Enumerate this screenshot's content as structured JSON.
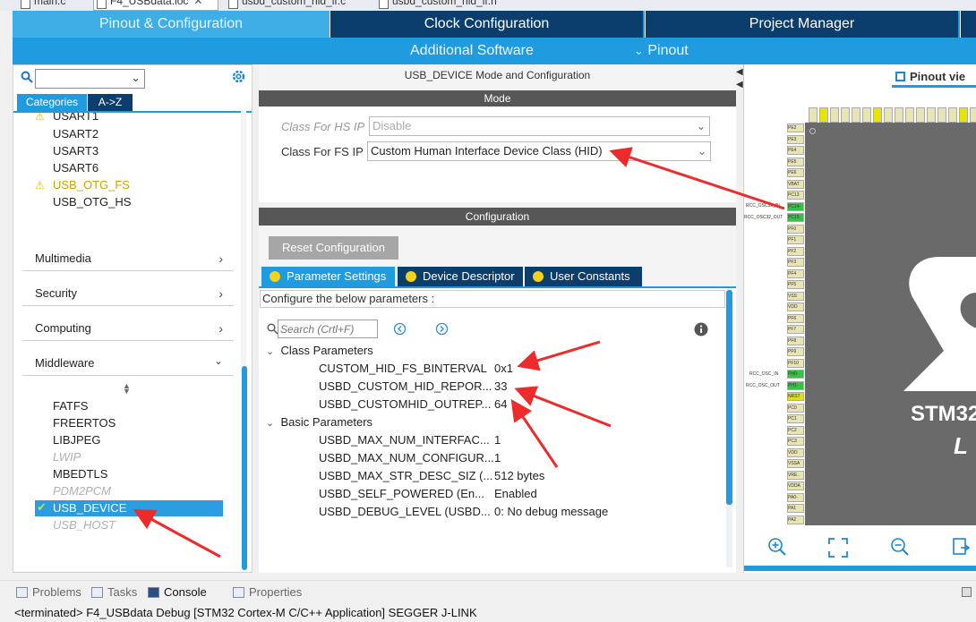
{
  "editor_tabs": [
    {
      "label": "main.c"
    },
    {
      "label": "F4_USBdata.ioc",
      "close": "✕"
    },
    {
      "label": "usbd_custom_hid_if.c"
    },
    {
      "label": "usbd_custom_hid_if.h"
    }
  ],
  "topnav": {
    "tabs": [
      "Pinout & Configuration",
      "Clock Configuration",
      "Project Manager"
    ],
    "additional_software": "Additional Software",
    "pinout": "Pinout"
  },
  "left": {
    "search_value": "",
    "category_tabs": [
      "Categories",
      "A->Z"
    ],
    "connectivity_items": [
      {
        "label": "USART1",
        "warn": true
      },
      {
        "label": "USART2",
        "warn": false
      },
      {
        "label": "USART3",
        "warn": false
      },
      {
        "label": "USART6",
        "warn": false
      },
      {
        "label": "USB_OTG_FS",
        "warn": true
      },
      {
        "label": "USB_OTG_HS",
        "warn": false
      }
    ],
    "groups": [
      "Multimedia",
      "Security",
      "Computing",
      "Middleware"
    ],
    "middleware_items": [
      {
        "label": "FATFS",
        "state": "normal"
      },
      {
        "label": "FREERTOS",
        "state": "normal"
      },
      {
        "label": "LIBJPEG",
        "state": "normal"
      },
      {
        "label": "LWIP",
        "state": "disabled"
      },
      {
        "label": "MBEDTLS",
        "state": "normal"
      },
      {
        "label": "PDM2PCM",
        "state": "disabled"
      },
      {
        "label": "USB_DEVICE",
        "state": "selected"
      },
      {
        "label": "USB_HOST",
        "state": "disabled"
      }
    ]
  },
  "mode": {
    "header": "USB_DEVICE Mode and Configuration",
    "section": "Mode",
    "hs_label": "Class For HS IP",
    "hs_value": "Disable",
    "fs_label": "Class For FS IP",
    "fs_value": "Custom Human Interface Device Class (HID)"
  },
  "config": {
    "section": "Configuration",
    "reset_button": "Reset Configuration",
    "tabs": [
      "Parameter Settings",
      "Device Descriptor",
      "User Constants"
    ],
    "hint": "Configure the below parameters :",
    "search_placeholder": "Search (Crtl+F)",
    "groups": [
      {
        "name": "Class Parameters",
        "params": [
          {
            "name": "CUSTOM_HID_FS_BINTERVAL",
            "value": "0x1"
          },
          {
            "name": "USBD_CUSTOM_HID_REPOR...",
            "value": "33"
          },
          {
            "name": "USBD_CUSTOMHID_OUTREP...",
            "value": "64"
          }
        ]
      },
      {
        "name": "Basic Parameters",
        "params": [
          {
            "name": "USBD_MAX_NUM_INTERFAC...",
            "value": "1"
          },
          {
            "name": "USBD_MAX_NUM_CONFIGUR...",
            "value": "1"
          },
          {
            "name": "USBD_MAX_STR_DESC_SIZ (...",
            "value": "512 bytes"
          },
          {
            "name": "USBD_SELF_POWERED (En...",
            "value": "Enabled"
          },
          {
            "name": "USBD_DEBUG_LEVEL (USBD...",
            "value": "0: No debug message"
          }
        ]
      }
    ]
  },
  "pinout_view": {
    "tab": "Pinout vie",
    "chip_text_1": "STM32",
    "chip_text_2": "L",
    "left_pins": [
      "PE2",
      "PE3",
      "PE4",
      "PE5",
      "PE6",
      "VBAT",
      "PC13",
      "PC14-",
      "PC15-",
      "PF0",
      "PF1",
      "PF2",
      "PF3",
      "PF4",
      "PF5",
      "VSS",
      "VDD",
      "PF6",
      "PF7",
      "PF8",
      "PF9",
      "PF10",
      "PH0-",
      "PH1-",
      "NRST",
      "PC0",
      "PC1",
      "PC2",
      "PC3",
      "VDD",
      "VSSA",
      "VRE..",
      "VDDA",
      "PA0-",
      "PA1",
      "PA2"
    ],
    "pin_labels": [
      "RCC_OSC32_IN",
      "RCC_OSC32_OUT",
      "RCC_OSC_IN",
      "RCC_OSC_OUT"
    ]
  },
  "bottom": {
    "tabs": [
      "Problems",
      "Tasks",
      "Console",
      "Properties"
    ],
    "console_line": "<terminated> F4_USBdata Debug [STM32 Cortex-M C/C++ Application] SEGGER J-LINK"
  }
}
